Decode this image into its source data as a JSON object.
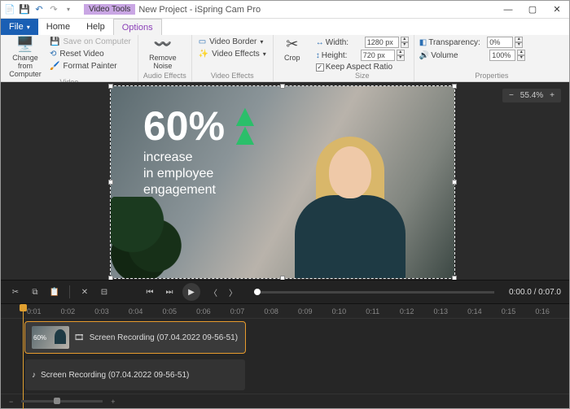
{
  "title": {
    "contextual": "Video Tools",
    "project": "New Project - iSpring Cam Pro"
  },
  "tabs": {
    "file": "File",
    "home": "Home",
    "help": "Help",
    "options": "Options"
  },
  "ribbon": {
    "video": {
      "change_from_computer": "Change from\nComputer",
      "save_on_computer": "Save on Computer",
      "reset_video": "Reset Video",
      "format_painter": "Format Painter",
      "label": "Video"
    },
    "audio": {
      "remove_noise": "Remove\nNoise",
      "label": "Audio Effects"
    },
    "veffects": {
      "border": "Video Border",
      "effects": "Video Effects",
      "label": "Video Effects"
    },
    "crop": {
      "btn": "Crop"
    },
    "size": {
      "width_lbl": "Width:",
      "width_val": "1280 px",
      "height_lbl": "Height:",
      "height_val": "720 px",
      "keep_ar": "Keep Aspect Ratio",
      "label": "Size"
    },
    "props": {
      "transparency_lbl": "Transparency:",
      "transparency_val": "0%",
      "volume_lbl": "Volume",
      "volume_val": "100%",
      "label": "Properties"
    }
  },
  "zoom": {
    "value": "55.4%"
  },
  "overlay": {
    "pct": "60%",
    "line1": "increase",
    "line2": "in employee",
    "line3": "engagement"
  },
  "playback": {
    "time": "0:00.0 / 0:07.0"
  },
  "ruler": [
    "0:01",
    "0:02",
    "0:03",
    "0:04",
    "0:05",
    "0:06",
    "0:07",
    "0:08",
    "0:09",
    "0:10",
    "0:11",
    "0:12",
    "0:13",
    "0:14",
    "0:15",
    "0:16"
  ],
  "tracks": {
    "video_clip": "Screen Recording (07.04.2022 09-56-51)",
    "audio_clip": "Screen Recording (07.04.2022 09-56-51)",
    "thumb_txt": "60%"
  }
}
